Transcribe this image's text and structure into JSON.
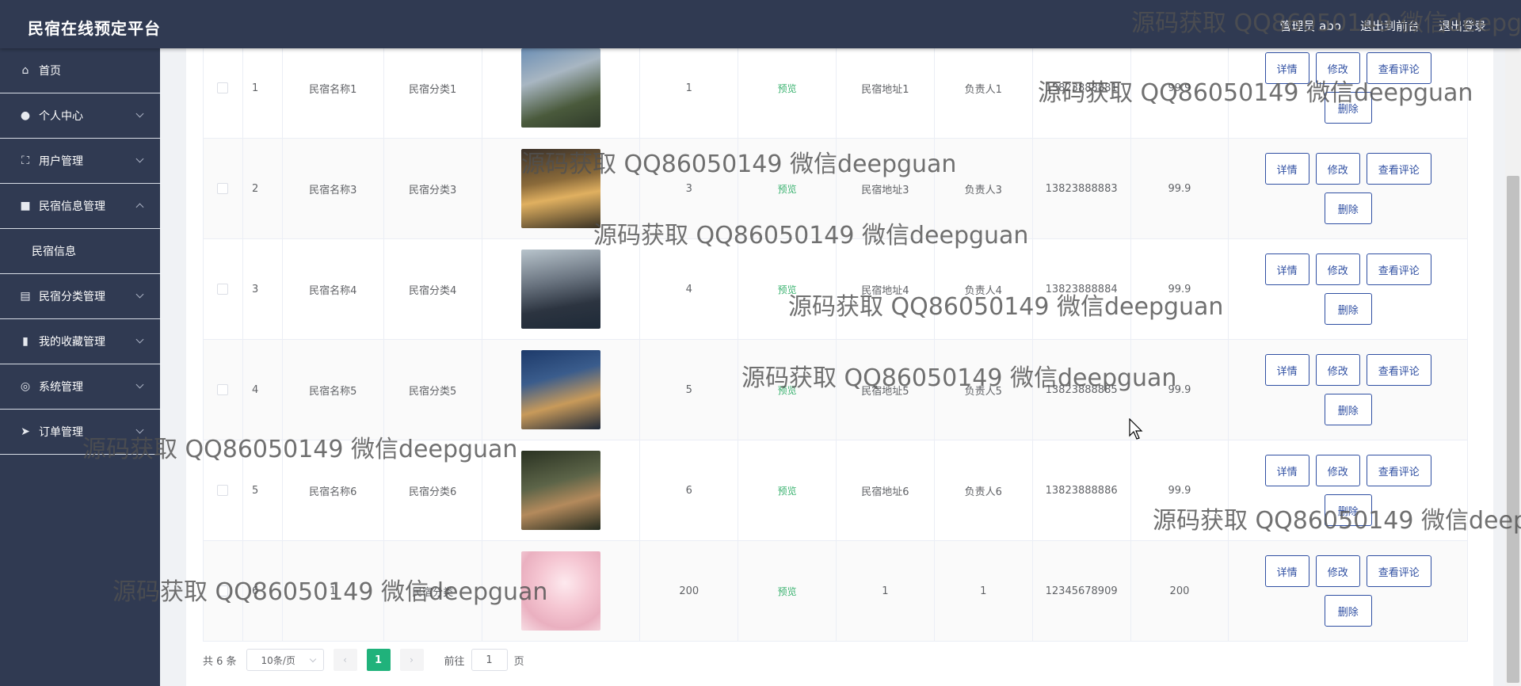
{
  "app": {
    "title": "民宿在线预定平台"
  },
  "header": {
    "admin": "管理员 abo",
    "front": "退出到前台",
    "logout": "退出登录"
  },
  "sidebar": {
    "items": [
      {
        "label": "首页",
        "icon": "home-icon",
        "glyph": "⌂"
      },
      {
        "label": "个人中心",
        "icon": "user-icon",
        "glyph": "●"
      },
      {
        "label": "用户管理",
        "icon": "users-icon",
        "glyph": "⛶"
      },
      {
        "label": "民宿信息管理",
        "icon": "briefcase-icon",
        "glyph": "■"
      },
      {
        "label": "民宿分类管理",
        "icon": "list-icon",
        "glyph": "▤"
      },
      {
        "label": "我的收藏管理",
        "icon": "bar-chart-icon",
        "glyph": "▮"
      },
      {
        "label": "系统管理",
        "icon": "settings-icon",
        "glyph": "◎"
      },
      {
        "label": "订单管理",
        "icon": "send-icon",
        "glyph": "➤"
      }
    ],
    "submenu": {
      "label": "民宿信息"
    }
  },
  "table": {
    "preview_label": "预览",
    "rows": [
      {
        "idx": "1",
        "name": "民宿名称1",
        "category": "民宿分类1",
        "num": "1",
        "address": "民宿地址1",
        "owner": "负责人1",
        "phone": "13823888881",
        "price": "99.9"
      },
      {
        "idx": "2",
        "name": "民宿名称3",
        "category": "民宿分类3",
        "num": "3",
        "address": "民宿地址3",
        "owner": "负责人3",
        "phone": "13823888883",
        "price": "99.9"
      },
      {
        "idx": "3",
        "name": "民宿名称4",
        "category": "民宿分类4",
        "num": "4",
        "address": "民宿地址4",
        "owner": "负责人4",
        "phone": "13823888884",
        "price": "99.9"
      },
      {
        "idx": "4",
        "name": "民宿名称5",
        "category": "民宿分类5",
        "num": "5",
        "address": "民宿地址5",
        "owner": "负责人5",
        "phone": "13823888885",
        "price": "99.9"
      },
      {
        "idx": "5",
        "name": "民宿名称6",
        "category": "民宿分类6",
        "num": "6",
        "address": "民宿地址6",
        "owner": "负责人6",
        "phone": "13823888886",
        "price": "99.9"
      },
      {
        "idx": "6",
        "name": "1",
        "category": "民宿分类",
        "num": "200",
        "address": "1",
        "owner": "1",
        "phone": "12345678909",
        "price": "200"
      }
    ]
  },
  "actions": {
    "detail": "详情",
    "edit": "修改",
    "review": "查看评论",
    "delete": "删除"
  },
  "pagination": {
    "total": "共 6 条",
    "size": "10条/页",
    "current": "1",
    "goto": "前往",
    "page_input": "1",
    "page_unit": "页",
    "prev": "‹",
    "next": "›"
  },
  "watermark": {
    "text": "源码获取 QQ86050149 微信deepguan"
  }
}
